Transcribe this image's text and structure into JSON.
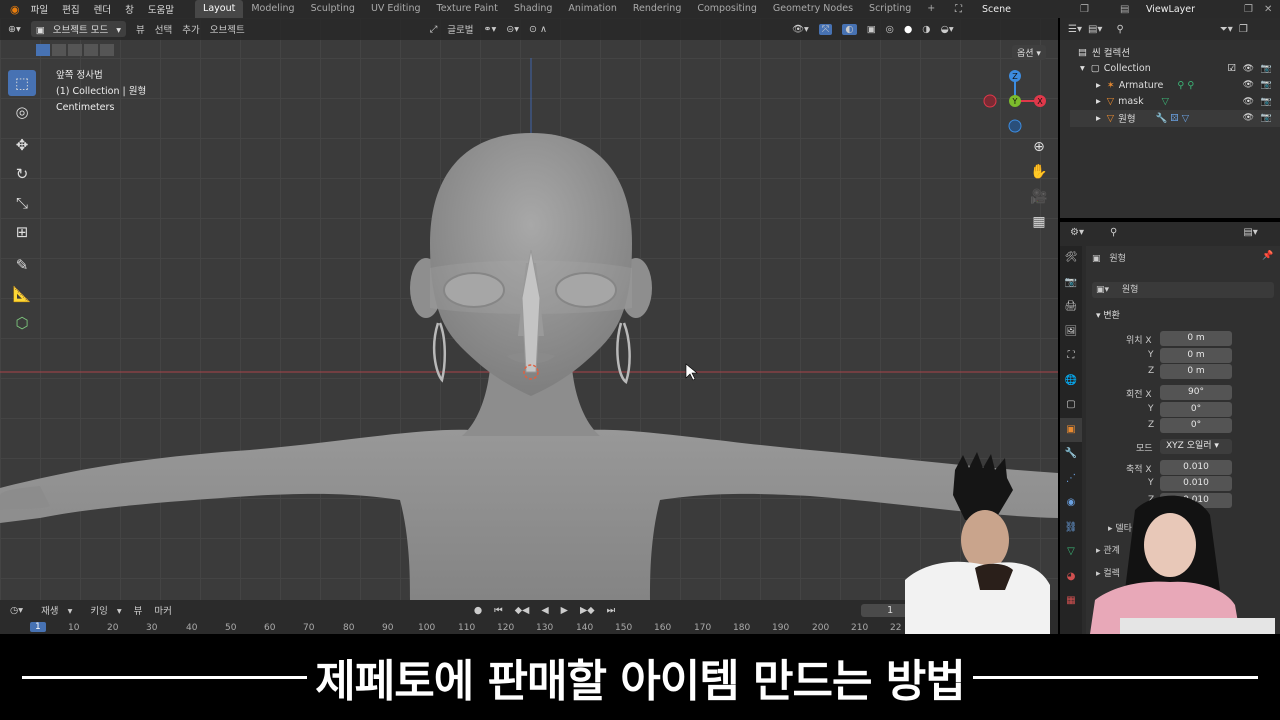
{
  "topbar": {
    "menus": [
      "파일",
      "편집",
      "렌더",
      "창",
      "도움말"
    ],
    "workspaces": [
      "Layout",
      "Modeling",
      "Sculpting",
      "UV Editing",
      "Texture Paint",
      "Shading",
      "Animation",
      "Rendering",
      "Compositing",
      "Geometry Nodes",
      "Scripting"
    ],
    "add_tab": "+",
    "scene": "Scene",
    "viewlayer": "ViewLayer"
  },
  "viewport_header": {
    "mode": "오브젝트 모드",
    "menus": [
      "뷰",
      "선택",
      "추가",
      "오브젝트"
    ],
    "transform_orientation": "글로벌",
    "options": "옵션"
  },
  "viewport_info": {
    "view_name": "앞쪽 정사법",
    "collection": "(1) Collection | 원형",
    "units": "Centimeters"
  },
  "gizmo": {
    "z": "Z",
    "y": "Y",
    "x": "X"
  },
  "outliner": {
    "scene_collection": "씬 컬렉션",
    "collection": "Collection",
    "items": [
      {
        "label": "Armature"
      },
      {
        "label": "mask"
      },
      {
        "label": "원형"
      }
    ]
  },
  "properties": {
    "object_name": "원형",
    "object_field": "원형",
    "section_transform": "변환",
    "location_label": "위치 X",
    "location": {
      "x": "0 m",
      "y": "0 m",
      "z": "0 m"
    },
    "rotation_label": "회전 X",
    "rotation": {
      "x": "90°",
      "y": "0°",
      "z": "0°"
    },
    "mode_label": "모드",
    "mode_value": "XYZ 오일러",
    "scale_label": "축적 X",
    "scale": {
      "x": "0.010",
      "y": "0.010",
      "z": "0.010"
    },
    "axis_y": "Y",
    "axis_z": "Z",
    "delta": "델타",
    "relations": "관계",
    "collections": "컬렉"
  },
  "timeline": {
    "menus": [
      "재생",
      "키잉",
      "뷰",
      "마커"
    ],
    "current_frame": "1",
    "ticks": [
      "1",
      "10",
      "20",
      "30",
      "40",
      "50",
      "60",
      "70",
      "80",
      "90",
      "100",
      "110",
      "120",
      "130",
      "140",
      "150",
      "160",
      "170",
      "180",
      "190",
      "200",
      "210",
      "22"
    ]
  },
  "subtitle": "제페토에 판매할 아이템 만드는 방법",
  "colors": {
    "accent": "#4772b3",
    "x_axis": "#e0384a",
    "y_axis": "#7cbc2c",
    "z_axis": "#3c8ce0"
  }
}
